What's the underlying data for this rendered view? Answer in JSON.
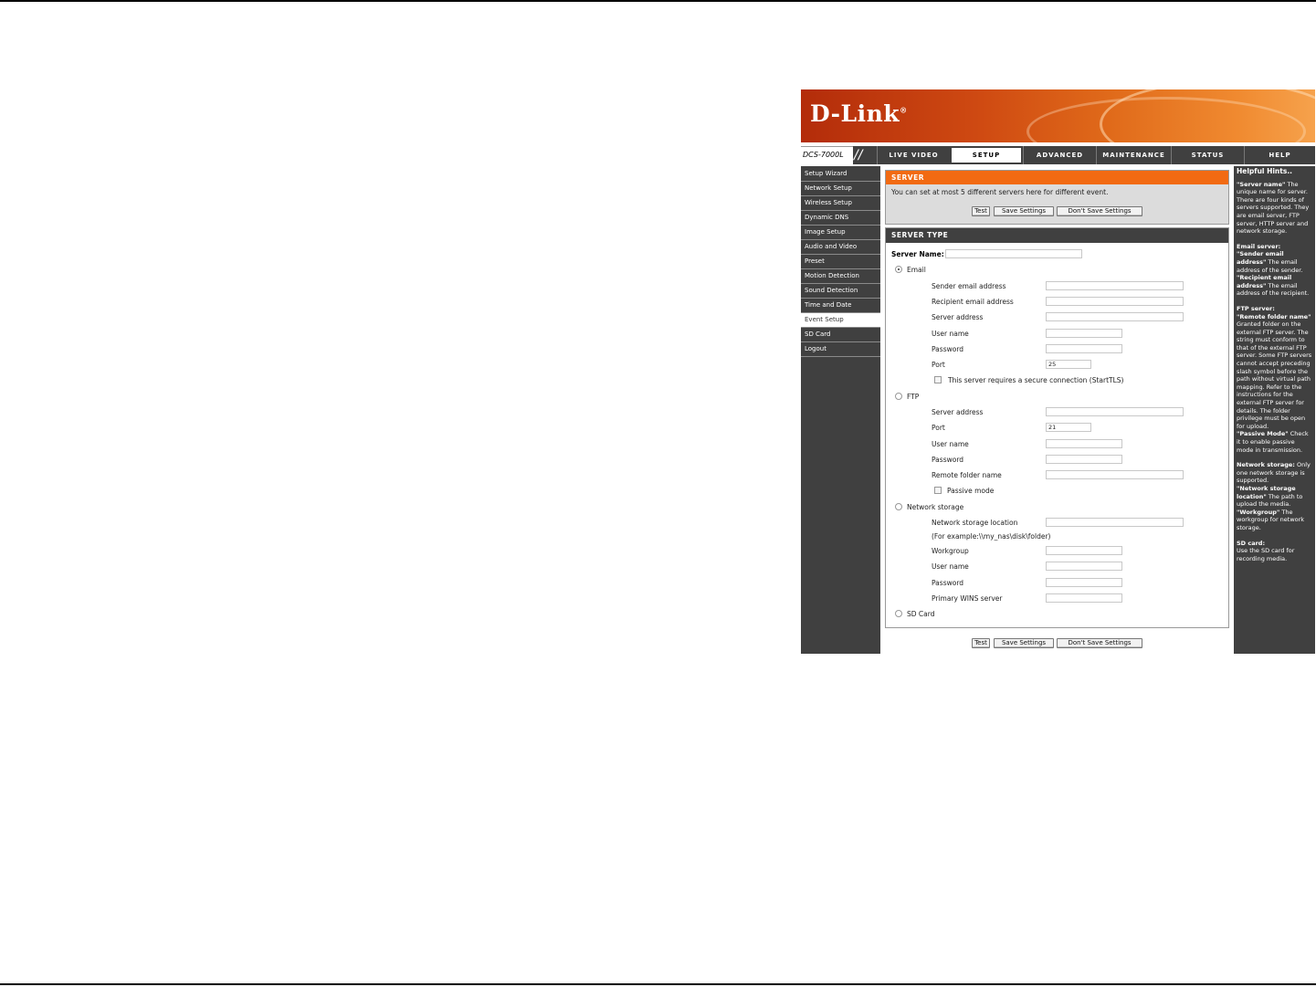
{
  "brand": {
    "logo": "D-Link",
    "logo_mark": "®",
    "model": "DCS-7000L"
  },
  "nav": {
    "tabs": [
      "LIVE VIDEO",
      "SETUP",
      "ADVANCED",
      "MAINTENANCE",
      "STATUS",
      "HELP"
    ],
    "active_tab": "SETUP"
  },
  "sidebar": {
    "items": [
      "Setup Wizard",
      "Network Setup",
      "Wireless Setup",
      "Dynamic DNS",
      "Image Setup",
      "Audio and Video",
      "Preset",
      "Motion Detection",
      "Sound Detection",
      "Time and Date",
      "Event Setup",
      "SD Card",
      "Logout"
    ],
    "active_item": "Event Setup"
  },
  "server_section": {
    "title": "SERVER",
    "description": "You can set at most 5 different servers here for different event.",
    "buttons": {
      "test": "Test",
      "save": "Save Settings",
      "dont_save": "Don't Save Settings"
    }
  },
  "server_type": {
    "title": "SERVER TYPE",
    "server_name_label": "Server Name:",
    "server_name_value": "",
    "selected_type": "Email",
    "email": {
      "label": "Email",
      "sender_label": "Sender email address",
      "recipient_label": "Recipient email address",
      "server_label": "Server address",
      "user_label": "User name",
      "password_label": "Password",
      "port_label": "Port",
      "port_value": "25",
      "starttls_label": "This server requires a secure connection (StartTLS)"
    },
    "ftp": {
      "label": "FTP",
      "server_label": "Server address",
      "port_label": "Port",
      "port_value": "21",
      "user_label": "User name",
      "password_label": "Password",
      "folder_label": "Remote folder name",
      "passive_label": "Passive mode"
    },
    "network_storage": {
      "label": "Network storage",
      "location_label": "Network storage location",
      "example": "(For example:\\\\my_nas\\disk\\folder)",
      "workgroup_label": "Workgroup",
      "user_label": "User name",
      "password_label": "Password",
      "wins_label": "Primary WINS server"
    },
    "sd_card": {
      "label": "SD Card"
    }
  },
  "bottom_buttons": {
    "test": "Test",
    "save": "Save Settings",
    "dont_save": "Don't Save Settings"
  },
  "help": {
    "title": "Helpful Hints..",
    "server_name_term": "\"Server name\"",
    "server_name_text": "The unique name for server. There are four kinds of servers supported. They are email server, FTP server, HTTP server and network storage.",
    "email_heading": "Email server:",
    "sender_term": "\"Sender email address\"",
    "sender_text": "The email address of the sender.",
    "recipient_term": "\"Recipient email address\"",
    "recipient_text": "The email address of the recipient.",
    "ftp_heading": "FTP server:",
    "folder_term": "\"Remote folder name\"",
    "folder_text": "Granted folder on the external FTP server. The string must conform to that of the external FTP server. Some FTP servers cannot accept preceding slash symbol before the path without virtual path mapping. Refer to the instructions for the external FTP server for details. The folder privilege must be open for upload.",
    "passive_term": "\"Passive Mode\"",
    "passive_text": "Check it to enable passive mode in transmission.",
    "ns_heading": "Network storage:",
    "ns_text": "Only one network storage is supported.",
    "ns_location_term": "\"Network storage location\"",
    "ns_location_text": "The path to upload the media.",
    "workgroup_term": "\"Workgroup\"",
    "workgroup_text": "The workgroup for network storage.",
    "sd_heading": "SD card:",
    "sd_text": "Use the SD card for recording media."
  }
}
